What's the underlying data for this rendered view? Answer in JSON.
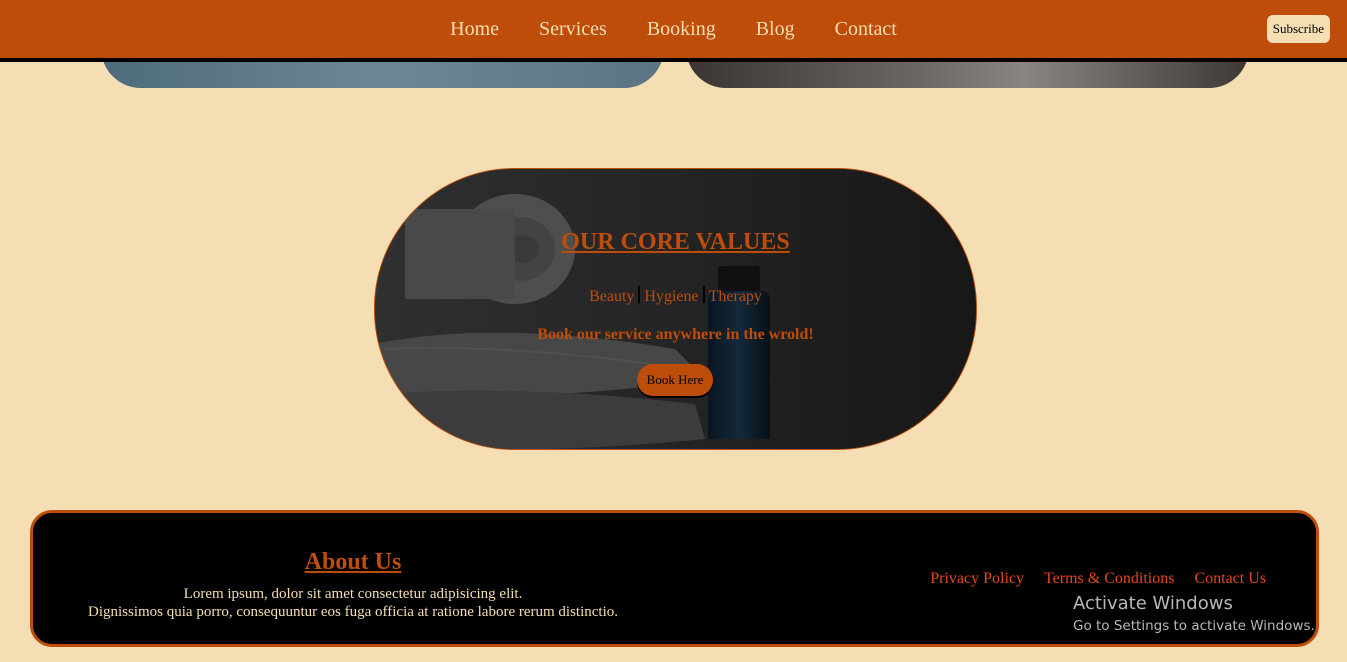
{
  "nav": {
    "links": [
      "Home",
      "Services",
      "Booking",
      "Blog",
      "Contact"
    ],
    "subscribe_label": "Subscribe"
  },
  "values": {
    "title": "OUR CORE VALUES",
    "items": [
      "Beauty",
      "Hygiene",
      "Therapy"
    ],
    "tagline": "Book our service anywhere in the wrold!",
    "button_label": "Book Here"
  },
  "footer": {
    "about_title": "About Us",
    "about_line1": "Lorem ipsum, dolor sit amet consectetur adipisicing elit.",
    "about_line2": "Dignissimos quia porro, consequuntur eos fuga officia at ratione labore rerum distinctio.",
    "links": [
      "Privacy Policy",
      "Terms & Conditions",
      "Contact Us"
    ]
  },
  "watermark": {
    "title": "Activate Windows",
    "subtitle": "Go to Settings to activate Windows."
  },
  "colors": {
    "accent": "#bf4d0a",
    "background": "#f5deb3",
    "footer_bg": "#000000",
    "link": "#e2481d"
  }
}
